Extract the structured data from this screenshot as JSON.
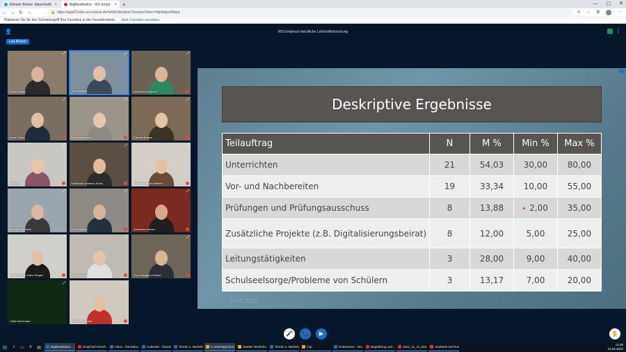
{
  "browser": {
    "tabs": [
      {
        "label": "Elfriede Birnbe: Meyerhoffs",
        "icon_color": "#1da1f2",
        "active": false
      },
      {
        "label": "BigBlueButton - WS Empir",
        "icon_color": "#d0312d",
        "active": true
      }
    ],
    "new_tab": "+",
    "url": "https://app22.bbb.uni-rostock.de/html5client/join?sessionToken=hljmfstjoel9dqvt",
    "favorites_prompt": "Platzieren Sie für den Schnellzugriff Ihre Favoriten in der Favoritenleiste.",
    "favorites_link": "Jetzt Favoriten verwalten"
  },
  "bbb": {
    "meeting_title": "WS Empirisch-berufliche Lehrkräfteforschung",
    "self_name": "Lea Besser"
  },
  "participants": [
    {
      "name": "Franz Haake",
      "bg": "#8a7b6a",
      "skin": "#d7b49a",
      "shirt": "#2a2a2a",
      "mic_muted": false,
      "speaking": false
    },
    {
      "name": "Lea Besser",
      "bg": "#7f8f9c",
      "skin": "#e2bfa6",
      "shirt": "#3b4a5a",
      "mic_muted": false,
      "speaking": true
    },
    {
      "name": "Alexandra Brukner",
      "bg": "#6b6255",
      "skin": "#d9b59a",
      "shirt": "#2c8a62",
      "mic_muted": true,
      "speaking": false
    },
    {
      "name": "Anne Timm",
      "bg": "#7a6e61",
      "skin": "#e0bfa6",
      "shirt": "#1f2a3a",
      "mic_muted": true,
      "speaking": false
    },
    {
      "name": "Caroline Laasch",
      "bg": "#9b9489",
      "skin": "#e6c8b0",
      "shirt": "#8d8a84",
      "mic_muted": true,
      "speaking": false
    },
    {
      "name": "Claudia Bottuer",
      "bg": "#7c6a56",
      "skin": "#e7c3a5",
      "shirt": "#3d3226",
      "mic_muted": true,
      "speaking": false
    },
    {
      "name": "Julia Lüd",
      "bg": "#c9c7c2",
      "skin": "#e8c6a8",
      "shirt": "#8a5566",
      "mic_muted": true,
      "speaking": false
    },
    {
      "name": "Katharina Vosbeck-Klose",
      "bg": "#5b4f43",
      "skin": "#e1bc9f",
      "shirt": "#2c2c2c",
      "mic_muted": true,
      "speaking": false
    },
    {
      "name": "Kathrin Pelzold-Wallrich",
      "bg": "#d4cfc6",
      "skin": "#e4c1a3",
      "shirt": "#6a4b3a",
      "mic_muted": true,
      "speaking": false
    },
    {
      "name": "Mandy Steinbeck",
      "bg": "#9aa5ad",
      "skin": "#dcb99e",
      "shirt": "#3a3a3a",
      "mic_muted": false,
      "speaking": false
    },
    {
      "name": "Nina Dietsch",
      "bg": "#8f8a84",
      "skin": "#d9b598",
      "shirt": "#223040",
      "mic_muted": true,
      "speaking": false
    },
    {
      "name": "Sebastian Grewe",
      "bg": "#7a2a1e",
      "skin": "#d6a98a",
      "shirt": "#1f1f1f",
      "mic_muted": true,
      "speaking": false
    },
    {
      "name": "Sonja Becker-Hahn Siegert",
      "bg": "#d1cfca",
      "skin": "#e2c1a7",
      "shirt": "#1b1b1b",
      "mic_muted": true,
      "speaking": false
    },
    {
      "name": "Tamara Noldt",
      "bg": "#bfbab2",
      "skin": "#e5c4a7",
      "shirt": "#dfdfdf",
      "mic_muted": true,
      "speaking": false
    },
    {
      "name": "Timo Wiegand-Kölbert",
      "bg": "#6e6559",
      "skin": "#d9b496",
      "shirt": "#2a2e35",
      "mic_muted": true,
      "speaking": false
    },
    {
      "name": "Ulrike Buchmann",
      "bg": "#0f2a14",
      "skin": "#0f2a14",
      "shirt": "#0f2a14",
      "mic_muted": false,
      "speaking": false
    },
    {
      "name": "Ulrike Buchmann",
      "bg": "#cfc9bf",
      "skin": "#e4c0a2",
      "shirt": "#c0302a",
      "mic_muted": true,
      "speaking": false
    }
  ],
  "slide": {
    "title": "Deskriptive Ergebnisse",
    "headers": [
      "Teilauftrag",
      "N",
      "M %",
      "Min %",
      "Max %"
    ],
    "rows": [
      {
        "task": "Unterrichten",
        "n": "21",
        "m": "54,03",
        "min": "30,00",
        "max": "80,00"
      },
      {
        "task": "Vor- und Nachbereiten",
        "n": "19",
        "m": "33,34",
        "min": "10,00",
        "max": "55,00"
      },
      {
        "task": "Prüfungen und Prüfungsausschuss",
        "n": "8",
        "m": "13,88",
        "min": "2,00",
        "max": "35,00"
      },
      {
        "task": "Zusätzliche Projekte (z.B. Digitalisierungsbeirat)",
        "n": "8",
        "m": "12,00",
        "min": "5,00",
        "max": "25,00"
      },
      {
        "task": "Leitungstätigkeiten",
        "n": "3",
        "m": "28,00",
        "min": "9,00",
        "max": "40,00"
      },
      {
        "task": "Schulseelsorge/Probleme von Schülern",
        "n": "3",
        "m": "13,17",
        "min": "7,00",
        "max": "20,00"
      }
    ],
    "date": "24.02.2022"
  },
  "taskbar": {
    "items": [
      {
        "label": "BigBlueButton - ...",
        "color": "#1b6ec2",
        "on": true
      },
      {
        "label": "Empirisch-berufl...",
        "color": "#d0312d",
        "on": false
      },
      {
        "label": "Inbox - franziska...",
        "color": "#1b6ec2",
        "on": false
      },
      {
        "label": "Calendar - franzis...",
        "color": "#1b6ec2",
        "on": false
      },
      {
        "label": "Termin 1. Worksh...",
        "color": "#1b6ec2",
        "on": false
      },
      {
        "label": "4 Unterlagen(en)",
        "color": "#e6a82a",
        "on": true
      },
      {
        "label": "Zweiter Worksho...",
        "color": "#e6a82a",
        "on": false
      },
      {
        "label": "Termin 2. Worksh...",
        "color": "#1b6ec2",
        "on": false
      },
      {
        "label": "Fop",
        "color": "#e6a82a",
        "on": false
      },
      {
        "label": "Dokument1 - Wo...",
        "color": "#1b6ec2",
        "on": false
      },
      {
        "label": "Begrüßung und ...",
        "color": "#d0312d",
        "on": false
      },
      {
        "label": "2021_11_11_Mor...",
        "color": "#d0312d",
        "on": false
      },
      {
        "label": "AnyDesk Uni Rost...",
        "color": "#e03030",
        "on": false
      }
    ],
    "time": "13:39",
    "date": "24.02.2022"
  }
}
